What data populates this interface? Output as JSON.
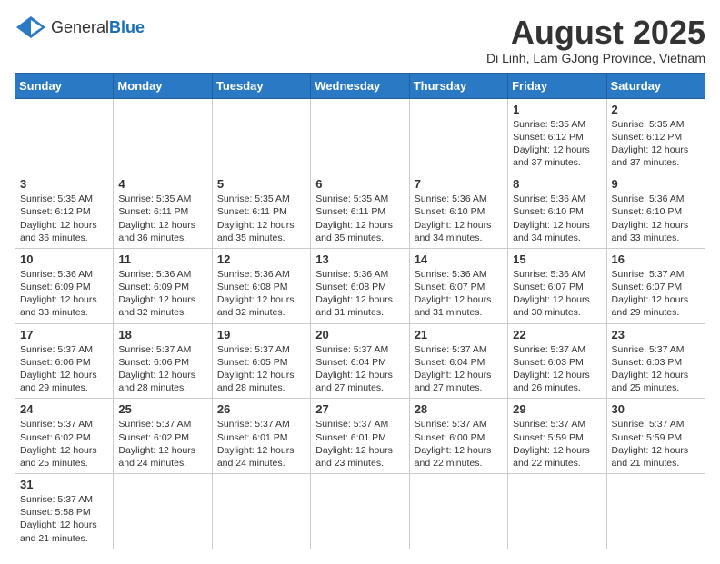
{
  "header": {
    "logo_general": "General",
    "logo_blue": "Blue",
    "month_title": "August 2025",
    "location": "Di Linh, Lam GJong Province, Vietnam"
  },
  "days_of_week": [
    "Sunday",
    "Monday",
    "Tuesday",
    "Wednesday",
    "Thursday",
    "Friday",
    "Saturday"
  ],
  "weeks": [
    [
      {
        "day": "",
        "info": ""
      },
      {
        "day": "",
        "info": ""
      },
      {
        "day": "",
        "info": ""
      },
      {
        "day": "",
        "info": ""
      },
      {
        "day": "",
        "info": ""
      },
      {
        "day": "1",
        "info": "Sunrise: 5:35 AM\nSunset: 6:12 PM\nDaylight: 12 hours and 37 minutes."
      },
      {
        "day": "2",
        "info": "Sunrise: 5:35 AM\nSunset: 6:12 PM\nDaylight: 12 hours and 37 minutes."
      }
    ],
    [
      {
        "day": "3",
        "info": "Sunrise: 5:35 AM\nSunset: 6:12 PM\nDaylight: 12 hours and 36 minutes."
      },
      {
        "day": "4",
        "info": "Sunrise: 5:35 AM\nSunset: 6:11 PM\nDaylight: 12 hours and 36 minutes."
      },
      {
        "day": "5",
        "info": "Sunrise: 5:35 AM\nSunset: 6:11 PM\nDaylight: 12 hours and 35 minutes."
      },
      {
        "day": "6",
        "info": "Sunrise: 5:35 AM\nSunset: 6:11 PM\nDaylight: 12 hours and 35 minutes."
      },
      {
        "day": "7",
        "info": "Sunrise: 5:36 AM\nSunset: 6:10 PM\nDaylight: 12 hours and 34 minutes."
      },
      {
        "day": "8",
        "info": "Sunrise: 5:36 AM\nSunset: 6:10 PM\nDaylight: 12 hours and 34 minutes."
      },
      {
        "day": "9",
        "info": "Sunrise: 5:36 AM\nSunset: 6:10 PM\nDaylight: 12 hours and 33 minutes."
      }
    ],
    [
      {
        "day": "10",
        "info": "Sunrise: 5:36 AM\nSunset: 6:09 PM\nDaylight: 12 hours and 33 minutes."
      },
      {
        "day": "11",
        "info": "Sunrise: 5:36 AM\nSunset: 6:09 PM\nDaylight: 12 hours and 32 minutes."
      },
      {
        "day": "12",
        "info": "Sunrise: 5:36 AM\nSunset: 6:08 PM\nDaylight: 12 hours and 32 minutes."
      },
      {
        "day": "13",
        "info": "Sunrise: 5:36 AM\nSunset: 6:08 PM\nDaylight: 12 hours and 31 minutes."
      },
      {
        "day": "14",
        "info": "Sunrise: 5:36 AM\nSunset: 6:07 PM\nDaylight: 12 hours and 31 minutes."
      },
      {
        "day": "15",
        "info": "Sunrise: 5:36 AM\nSunset: 6:07 PM\nDaylight: 12 hours and 30 minutes."
      },
      {
        "day": "16",
        "info": "Sunrise: 5:37 AM\nSunset: 6:07 PM\nDaylight: 12 hours and 29 minutes."
      }
    ],
    [
      {
        "day": "17",
        "info": "Sunrise: 5:37 AM\nSunset: 6:06 PM\nDaylight: 12 hours and 29 minutes."
      },
      {
        "day": "18",
        "info": "Sunrise: 5:37 AM\nSunset: 6:06 PM\nDaylight: 12 hours and 28 minutes."
      },
      {
        "day": "19",
        "info": "Sunrise: 5:37 AM\nSunset: 6:05 PM\nDaylight: 12 hours and 28 minutes."
      },
      {
        "day": "20",
        "info": "Sunrise: 5:37 AM\nSunset: 6:04 PM\nDaylight: 12 hours and 27 minutes."
      },
      {
        "day": "21",
        "info": "Sunrise: 5:37 AM\nSunset: 6:04 PM\nDaylight: 12 hours and 27 minutes."
      },
      {
        "day": "22",
        "info": "Sunrise: 5:37 AM\nSunset: 6:03 PM\nDaylight: 12 hours and 26 minutes."
      },
      {
        "day": "23",
        "info": "Sunrise: 5:37 AM\nSunset: 6:03 PM\nDaylight: 12 hours and 25 minutes."
      }
    ],
    [
      {
        "day": "24",
        "info": "Sunrise: 5:37 AM\nSunset: 6:02 PM\nDaylight: 12 hours and 25 minutes."
      },
      {
        "day": "25",
        "info": "Sunrise: 5:37 AM\nSunset: 6:02 PM\nDaylight: 12 hours and 24 minutes."
      },
      {
        "day": "26",
        "info": "Sunrise: 5:37 AM\nSunset: 6:01 PM\nDaylight: 12 hours and 24 minutes."
      },
      {
        "day": "27",
        "info": "Sunrise: 5:37 AM\nSunset: 6:01 PM\nDaylight: 12 hours and 23 minutes."
      },
      {
        "day": "28",
        "info": "Sunrise: 5:37 AM\nSunset: 6:00 PM\nDaylight: 12 hours and 22 minutes."
      },
      {
        "day": "29",
        "info": "Sunrise: 5:37 AM\nSunset: 5:59 PM\nDaylight: 12 hours and 22 minutes."
      },
      {
        "day": "30",
        "info": "Sunrise: 5:37 AM\nSunset: 5:59 PM\nDaylight: 12 hours and 21 minutes."
      }
    ],
    [
      {
        "day": "31",
        "info": "Sunrise: 5:37 AM\nSunset: 5:58 PM\nDaylight: 12 hours and 21 minutes."
      },
      {
        "day": "",
        "info": ""
      },
      {
        "day": "",
        "info": ""
      },
      {
        "day": "",
        "info": ""
      },
      {
        "day": "",
        "info": ""
      },
      {
        "day": "",
        "info": ""
      },
      {
        "day": "",
        "info": ""
      }
    ]
  ]
}
